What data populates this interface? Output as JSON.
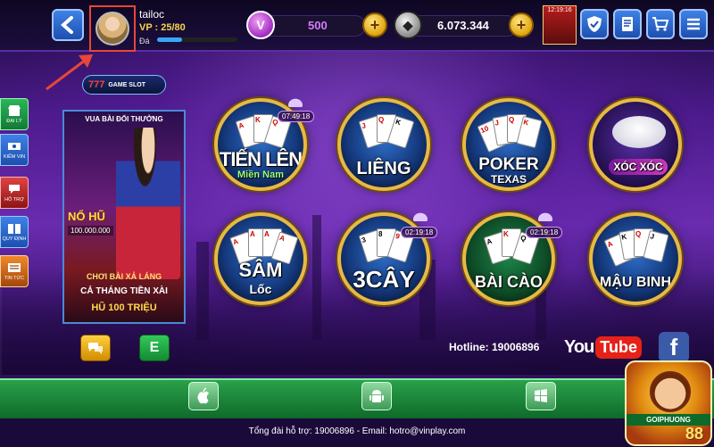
{
  "topbar": {
    "username": "tailoc",
    "vp_label": "VP : 25/80",
    "rank_label": "Đá",
    "xp_fraction": 0.31,
    "currency_1": {
      "value": "500",
      "icon": "V-coin-icon"
    },
    "currency_2": {
      "value": "6.073.344",
      "icon": "silver-coin-icon"
    },
    "event_time": "12:19:16"
  },
  "sidebar": {
    "items": [
      {
        "label": "ĐẠI LÝ",
        "icon": "store-icon"
      },
      {
        "label": "KIẾM VIN",
        "icon": "cash-icon"
      },
      {
        "label": "HỖ TRỢ",
        "icon": "chat-icon"
      },
      {
        "label": "QUY ĐỊNH",
        "icon": "book-icon"
      },
      {
        "label": "TIN TỨC",
        "icon": "news-icon"
      }
    ]
  },
  "slot_logo": {
    "number": "777",
    "text": "GAME SLOT"
  },
  "banner": {
    "top_text": "VUA BÀI ĐỔI THƯỞNG",
    "jackpot": "NỔ HŨ",
    "amount": "100.000.000",
    "line1": "CHƠI BÀI XẢ LÁNG",
    "line2": "CẢ THÁNG TIỀN XÀI",
    "line3": "HŨ 100 TRIỆU"
  },
  "games": [
    {
      "title": "TIẾN LÊN",
      "subtitle": "Miền Nam",
      "timer": "07:49:18"
    },
    {
      "title": "LIÊNG",
      "subtitle": "",
      "timer": ""
    },
    {
      "title": "POKER",
      "subtitle": "TEXAS",
      "timer": ""
    },
    {
      "title": "XÓC XÓC",
      "subtitle": "",
      "timer": ""
    },
    {
      "title": "SÂM",
      "subtitle": "Lốc",
      "timer": ""
    },
    {
      "title": "3CÂY",
      "subtitle": "",
      "timer": "02:19:18"
    },
    {
      "title": "BÀI CÀO",
      "subtitle": "",
      "timer": "02:19:18"
    },
    {
      "title": "MẬU BINH",
      "subtitle": "",
      "timer": ""
    }
  ],
  "hotline": "Hotline: 19006896",
  "youtube": {
    "you": "You",
    "tube": "Tube"
  },
  "facebook": "f",
  "footer": {
    "support_text": "Tổng đài hỗ trợ: 19006896 - Email: hotro@vinplay.com",
    "stores": [
      "apple-icon",
      "android-icon",
      "windows-icon"
    ]
  },
  "badge": {
    "text": "GOIPHUONG",
    "number": "88"
  },
  "colors": {
    "accent": "#e7b944",
    "primary_button": "#3f82e6",
    "background": "#4b1a8a",
    "footer": "#2aa14a"
  }
}
